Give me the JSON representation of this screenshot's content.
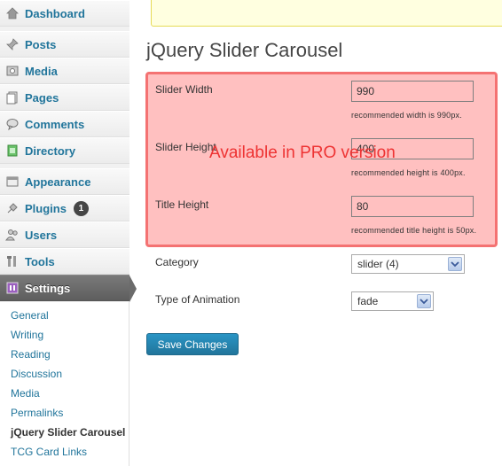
{
  "sidebar": {
    "items": [
      {
        "label": "Dashboard",
        "icon": "dashboard-icon"
      },
      {
        "label": "Posts",
        "icon": "pin-icon"
      },
      {
        "label": "Media",
        "icon": "media-icon"
      },
      {
        "label": "Pages",
        "icon": "pages-icon"
      },
      {
        "label": "Comments",
        "icon": "comment-icon"
      },
      {
        "label": "Directory",
        "icon": "directory-icon"
      },
      {
        "label": "Appearance",
        "icon": "appearance-icon"
      },
      {
        "label": "Plugins",
        "icon": "plugin-icon",
        "badge": "1"
      },
      {
        "label": "Users",
        "icon": "users-icon"
      },
      {
        "label": "Tools",
        "icon": "tools-icon"
      },
      {
        "label": "Settings",
        "icon": "settings-icon",
        "active": true
      }
    ],
    "submenu": [
      "General",
      "Writing",
      "Reading",
      "Discussion",
      "Media",
      "Permalinks",
      "jQuery Slider Carousel",
      "TCG Card Links"
    ],
    "submenu_current": "jQuery Slider Carousel"
  },
  "page": {
    "title": "jQuery Slider Carousel",
    "pro_watermark": "Available in PRO version"
  },
  "form": {
    "slider_width": {
      "label": "Slider Width",
      "value": "990",
      "hint": "recommended width is 990px."
    },
    "slider_height": {
      "label": "Slider Height",
      "value": "400",
      "hint": "recommended height is 400px."
    },
    "title_height": {
      "label": "Title Height",
      "value": "80",
      "hint": "recommended title height is 50px."
    },
    "category": {
      "label": "Category",
      "selected": "slider (4)"
    },
    "animation": {
      "label": "Type of Animation",
      "selected": "fade"
    },
    "save_label": "Save Changes"
  },
  "colors": {
    "link": "#21759b",
    "pro_box_fill": "#ffc0c0",
    "pro_box_border": "#f47272",
    "pro_watermark": "#ee3333",
    "button": "#21759b"
  }
}
